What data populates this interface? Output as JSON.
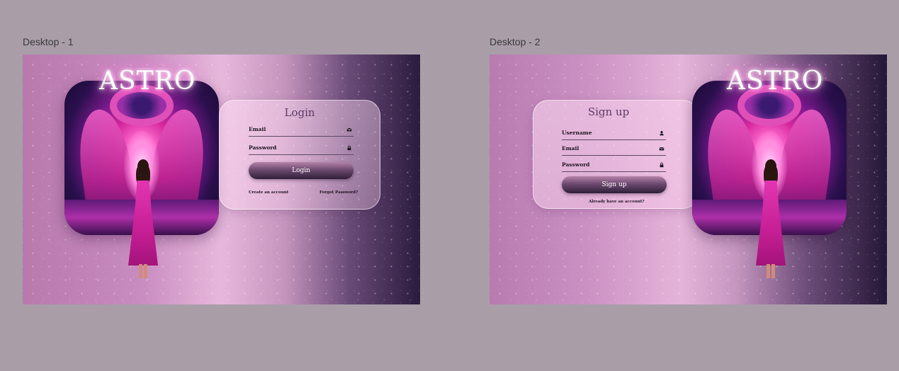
{
  "frames": [
    {
      "label": "Desktop - 1",
      "brand": "ASTRO",
      "form": {
        "title": "Login",
        "fields": [
          {
            "label": "Email",
            "icon": "mail-icon"
          },
          {
            "label": "Password",
            "icon": "lock-icon"
          }
        ],
        "button": "Login",
        "link_left": "Create an account",
        "link_right": "Forgot Password?"
      }
    },
    {
      "label": "Desktop - 2",
      "brand": "ASTRO",
      "form": {
        "title": "Sign up",
        "fields": [
          {
            "label": "Username",
            "icon": "user-icon"
          },
          {
            "label": "Email",
            "icon": "mail-icon"
          },
          {
            "label": "Password",
            "icon": "lock-icon"
          }
        ],
        "button": "Sign up",
        "link_center": "Already have an account?"
      }
    }
  ],
  "colors": {
    "canvas_bg": "#a99ea8",
    "button_dark": "#2f1f3a",
    "title_purple": "#5b3a67"
  }
}
